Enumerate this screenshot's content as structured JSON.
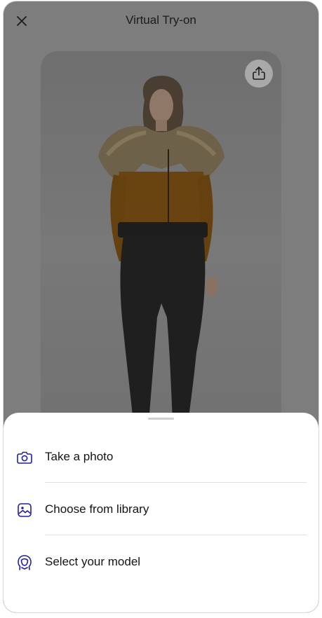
{
  "header": {
    "title": "Virtual Try-on",
    "close_icon": "close-icon"
  },
  "photo": {
    "share_icon": "share-icon"
  },
  "sheet": {
    "options": [
      {
        "label": "Take a photo",
        "icon": "camera-icon"
      },
      {
        "label": "Choose from library",
        "icon": "image-library-icon"
      },
      {
        "label": "Select your model",
        "icon": "model-face-icon"
      }
    ]
  },
  "colors": {
    "accent": "#1f1fa8",
    "overlay": "#7d7d7d",
    "sheet_bg": "#ffffff"
  }
}
